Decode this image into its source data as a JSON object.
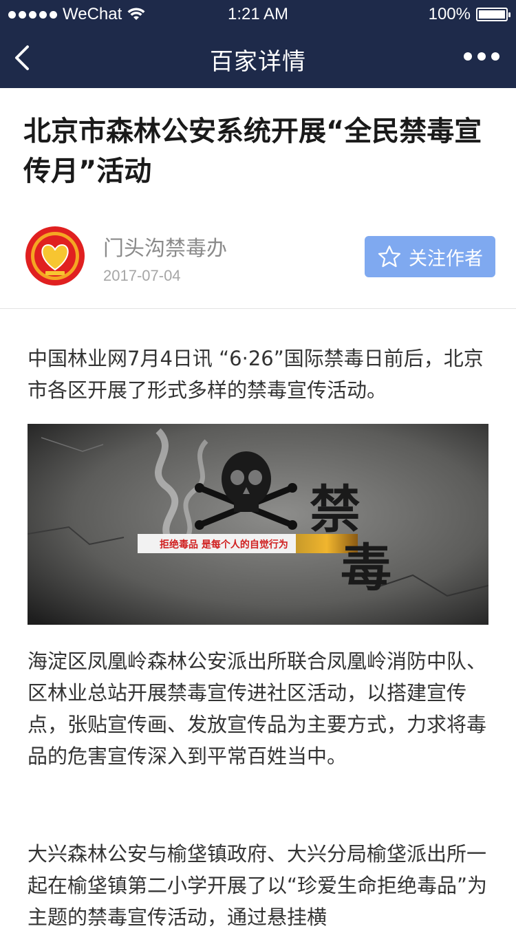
{
  "status_bar": {
    "carrier": "WeChat",
    "time": "1:21 AM",
    "battery_text": "100%",
    "battery_level": 1.0
  },
  "nav": {
    "title": "百家详情",
    "back_icon": "chevron-left-icon",
    "more_icon": "more-dots-icon"
  },
  "article": {
    "title": "北京市森林公安系统开展“全民禁毒宣传月”活动",
    "author": {
      "name": "门头沟禁毒办",
      "date": "2017-07-04",
      "follow_label": "关注作者"
    },
    "paragraphs": [
      "中国林业网7月4日讯 “6·26”国际禁毒日前后，北京市各区开展了形式多样的禁毒宣传活动。",
      "海淀区凤凰岭森林公安派出所联合凤凰岭消防中队、区林业总站开展禁毒宣传进社区活动，以搭建宣传点，张贴宣传画、发放宣传品为主要方式，力求将毒品的危害宣传深入到平常百姓当中。",
      "大兴森林公安与榆垡镇政府、大兴分局榆垡派出所一起在榆垡镇第二小学开展了以“珍爱生命拒绝毒品”为主题的禁毒宣传活动，通过悬挂横"
    ],
    "banner": {
      "slogan": "拒绝毒品 是每个人的自觉行为",
      "big_text_1": "禁",
      "big_text_2": "毒"
    }
  },
  "colors": {
    "nav_bg": "#1e2a4a",
    "follow_bg": "#7fa9f0",
    "avatar_red": "#e02020"
  }
}
